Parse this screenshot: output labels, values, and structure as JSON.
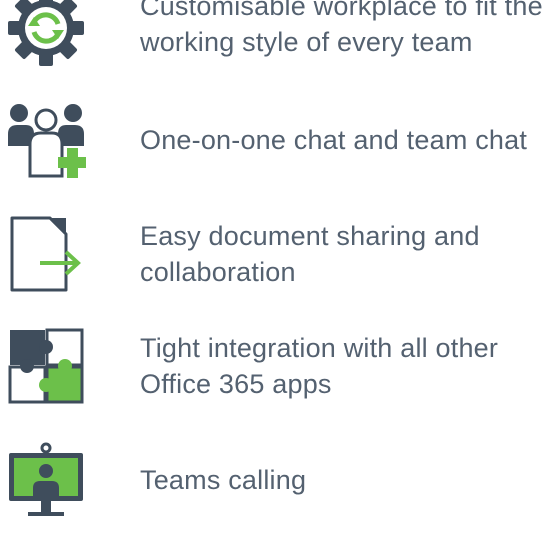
{
  "colors": {
    "icon_dark": "#3f4d5c",
    "icon_green": "#6cc04a",
    "text": "#546170"
  },
  "features": [
    {
      "icon": "gear-refresh-icon",
      "lines": [
        "Customisable workplace to fit the",
        "working style of every team"
      ]
    },
    {
      "icon": "people-add-icon",
      "lines": [
        "One-on-one chat and team chat"
      ]
    },
    {
      "icon": "document-share-icon",
      "lines": [
        "Easy document sharing and",
        "collaboration"
      ]
    },
    {
      "icon": "puzzle-icon",
      "lines": [
        "Tight integration with all other",
        "Office 365 apps"
      ]
    },
    {
      "icon": "video-monitor-icon",
      "lines": [
        "Teams calling"
      ]
    }
  ]
}
